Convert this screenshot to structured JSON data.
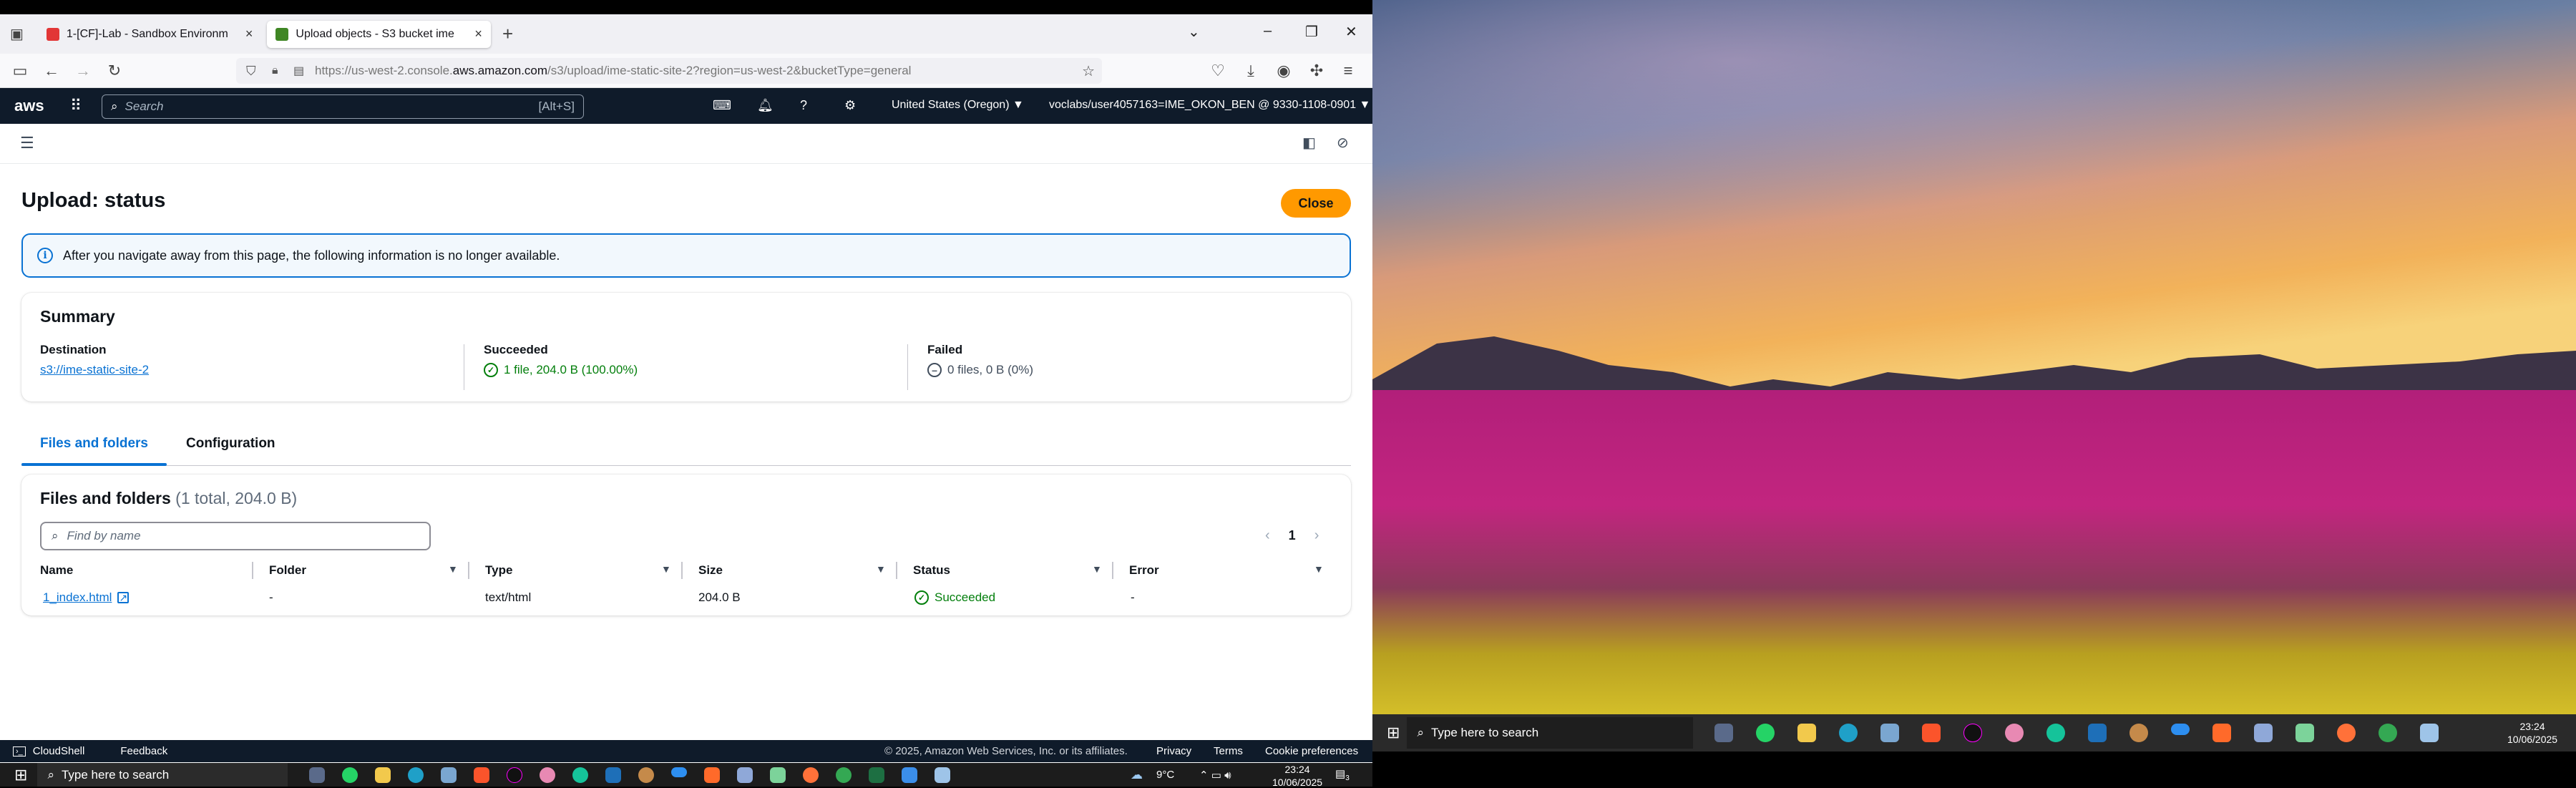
{
  "browser": {
    "tabs": [
      {
        "title": "1-[CF]-Lab - Sandbox Environm",
        "favicon_color": "#e23636",
        "active": false
      },
      {
        "title": "Upload objects - S3 bucket ime",
        "favicon_color": "#3f8624",
        "active": true
      }
    ],
    "new_tab_label": "+",
    "close_glyph": "×",
    "url_prefix": "https://us-west-2.console.",
    "url_domain": "aws.amazon.com",
    "url_rest": "/s3/upload/ime-static-site-2?region=us-west-2&bucketType=general"
  },
  "aws_nav": {
    "logo": "aws",
    "search_placeholder": "Search",
    "search_shortcut": "[Alt+S]",
    "region": "United States (Oregon) ▼",
    "account": "voclabs/user4057163=IME_OKON_BEN @ 9330-1108-0901 ▼"
  },
  "page": {
    "title": "Upload: status",
    "close_button": "Close",
    "info_message": "After you navigate away from this page, the following information is no longer available.",
    "info_icon": "i"
  },
  "summary": {
    "heading": "Summary",
    "destination_label": "Destination",
    "destination_value": "s3://ime-static-site-2",
    "succeeded_label": "Succeeded",
    "succeeded_value": "1 file, 204.0 B (100.00%)",
    "failed_label": "Failed",
    "failed_value": "0 files, 0 B (0%)"
  },
  "content_tabs": {
    "files": "Files and folders",
    "configuration": "Configuration"
  },
  "files_table": {
    "heading": "Files and folders",
    "count": "(1 total, 204.0 B)",
    "find_placeholder": "Find by name",
    "page_number": "1",
    "columns": [
      "Name",
      "Folder",
      "Type",
      "Size",
      "Status",
      "Error"
    ],
    "rows": [
      {
        "name": "1_index.html",
        "folder": "-",
        "type": "text/html",
        "size": "204.0 B",
        "status": "Succeeded",
        "error": "-"
      }
    ]
  },
  "footer": {
    "cloudshell": "CloudShell",
    "feedback": "Feedback",
    "copyright": "© 2025, Amazon Web Services, Inc. or its affiliates.",
    "privacy": "Privacy",
    "terms": "Terms",
    "cookies": "Cookie preferences"
  },
  "taskbar_left": {
    "search_placeholder": "Type here to search",
    "weather": "9°C",
    "time": "23:24",
    "date": "10/06/2025",
    "notifications": "3"
  },
  "taskbar_right": {
    "search_placeholder": "Type here to search",
    "time": "23:24",
    "date": "10/06/2025"
  },
  "colors": {
    "aws_nav": "#0f1b2a",
    "accent": "#0972d3",
    "success": "#037f0c",
    "orange": "#ff9900"
  }
}
